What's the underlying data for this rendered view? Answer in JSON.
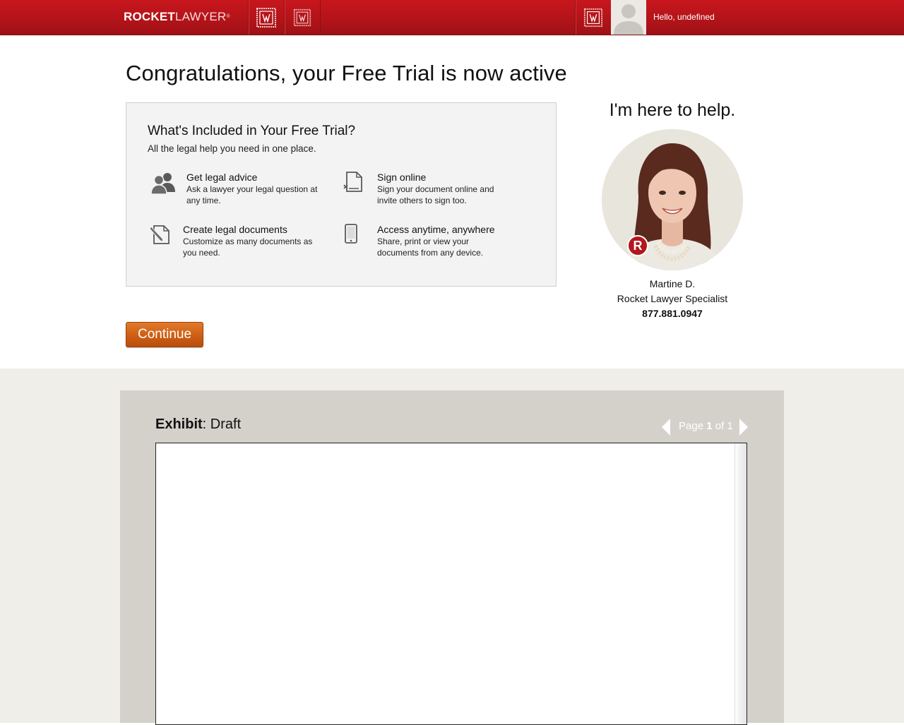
{
  "header": {
    "logo_bold": "ROCKET",
    "logo_light": "LAWYER",
    "logo_mark": "®",
    "nav_icons": [
      "legal-seal-icon",
      "legal-seal-icon",
      "legal-seal-icon"
    ],
    "greeting": "Hello, undefined",
    "brand_color": "#b31419"
  },
  "main": {
    "title": "Congratulations, your Free Trial is now active",
    "included": {
      "heading": "What's Included in Your Free Trial?",
      "subheading": "All the legal help you need in one place.",
      "features": [
        {
          "icon": "people-icon",
          "title": "Get legal advice",
          "desc": "Ask a lawyer your legal question at any time."
        },
        {
          "icon": "sign-document-icon",
          "title": "Sign online",
          "desc": "Sign your document online and invite others to sign too."
        },
        {
          "icon": "edit-document-icon",
          "title": "Create legal documents",
          "desc": "Customize as many documents as you need."
        },
        {
          "icon": "mobile-device-icon",
          "title": "Access anytime, anywhere",
          "desc": "Share, print or view your documents from any device."
        }
      ]
    },
    "continue_label": "Continue",
    "accent_color": "#cc5c13"
  },
  "help": {
    "heading": "I'm here to help.",
    "badge": "R",
    "name": "Martine D.",
    "role": "Rocket Lawyer Specialist",
    "phone": "877.881.0947"
  },
  "document": {
    "label_bold": "Exhibit",
    "label_rest": ": Draft",
    "page_word": "Page",
    "page_current": "1",
    "page_of": "of 1"
  }
}
